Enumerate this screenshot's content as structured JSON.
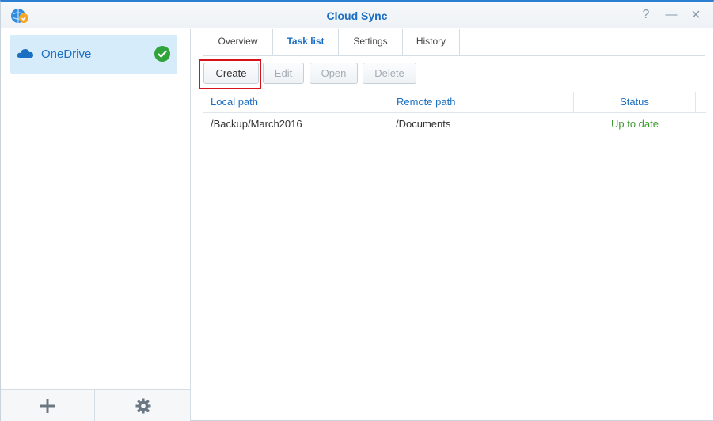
{
  "window": {
    "title": "Cloud Sync"
  },
  "title_buttons": {
    "help": "?",
    "minimize": "—",
    "close": "×"
  },
  "sidebar": {
    "items": [
      {
        "label": "OneDrive",
        "status": "connected"
      }
    ],
    "footer": {
      "add_icon": "plus-icon",
      "settings_icon": "gear-icon"
    }
  },
  "tabs": [
    {
      "label": "Overview",
      "active": false
    },
    {
      "label": "Task list",
      "active": true
    },
    {
      "label": "Settings",
      "active": false
    },
    {
      "label": "History",
      "active": false
    }
  ],
  "toolbar": {
    "create_label": "Create",
    "edit_label": "Edit",
    "open_label": "Open",
    "delete_label": "Delete"
  },
  "table": {
    "columns": [
      "Local path",
      "Remote path",
      "Status"
    ],
    "rows": [
      {
        "local_path": "/Backup/March2016",
        "remote_path": "/Documents",
        "status": "Up to date"
      }
    ]
  },
  "colors": {
    "accent": "#1b6fc2",
    "selected_bg": "#d7ecfb",
    "success": "#2ea43a",
    "highlight": "#d8121b"
  }
}
